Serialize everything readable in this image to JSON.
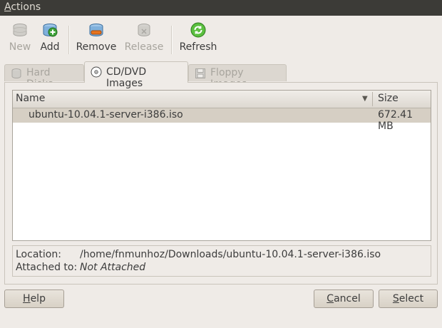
{
  "menubar": {
    "actions": "Actions"
  },
  "toolbar": {
    "new": "New",
    "add": "Add",
    "remove": "Remove",
    "release": "Release",
    "refresh": "Refresh"
  },
  "tabs": {
    "hard_disks": "Hard Disks",
    "cd_dvd": "CD/DVD Images",
    "floppy": "Floppy Images"
  },
  "list": {
    "headers": {
      "name": "Name",
      "size": "Size"
    },
    "rows": [
      {
        "name": "ubuntu-10.04.1-server-i386.iso",
        "size": "672.41 MB"
      }
    ]
  },
  "info": {
    "location_label": "Location:",
    "location_value": "/home/fnmunhoz/Downloads/ubuntu-10.04.1-server-i386.iso",
    "attached_label": "Attached to:",
    "attached_value": "Not Attached"
  },
  "buttons": {
    "help": "Help",
    "cancel": "Cancel",
    "select": "Select"
  }
}
